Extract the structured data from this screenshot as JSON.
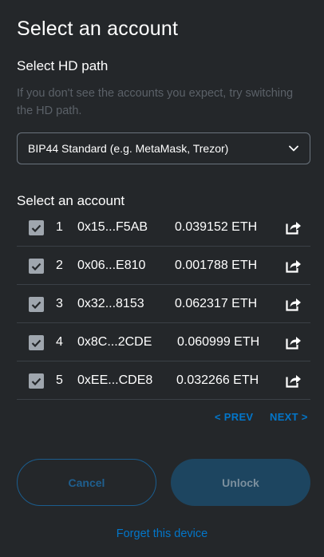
{
  "page": {
    "title": "Select an account"
  },
  "hd_path": {
    "title": "Select HD path",
    "help_text": "If you don't see the accounts you expect, try switching the HD path.",
    "selected": "BIP44 Standard (e.g. MetaMask, Trezor)"
  },
  "accounts": {
    "title": "Select an account",
    "rows": [
      {
        "index": "1",
        "address": "0x15...F5AB",
        "balance": "0.039152 ETH",
        "checked": true
      },
      {
        "index": "2",
        "address": "0x06...E810",
        "balance": "0.001788 ETH",
        "checked": true
      },
      {
        "index": "3",
        "address": "0x32...8153",
        "balance": "0.062317 ETH",
        "checked": true
      },
      {
        "index": "4",
        "address": "0x8C...2CDE",
        "balance": "0.060999 ETH",
        "checked": true
      },
      {
        "index": "5",
        "address": "0xEE...CDE8",
        "balance": "0.032266 ETH",
        "checked": true
      }
    ]
  },
  "pagination": {
    "prev": "< PREV",
    "next": "NEXT >"
  },
  "actions": {
    "cancel": "Cancel",
    "unlock": "Unlock",
    "forget": "Forget this device"
  },
  "colors": {
    "background": "#24272a",
    "link": "#0376c9",
    "checkbox": "#9fa6ae",
    "muted_text": "#5b6168"
  }
}
